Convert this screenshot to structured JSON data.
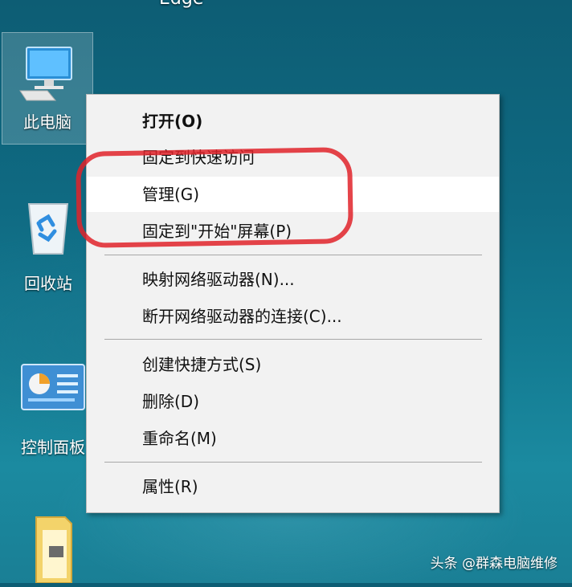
{
  "desktop": {
    "top_partial_label": "Edge",
    "icons": [
      {
        "label": "此电脑",
        "icon": "computer-icon"
      },
      {
        "label": "回收站",
        "icon": "recycle-bin-icon"
      },
      {
        "label": "控制面板",
        "icon": "control-panel-icon"
      },
      {
        "label": "",
        "icon": "folder-icon"
      }
    ]
  },
  "context_menu": {
    "items": [
      {
        "label": "打开(O)",
        "bold": true
      },
      {
        "label": "固定到快速访问"
      },
      {
        "label": "管理(G)",
        "highlighted": true
      },
      {
        "label": "固定到\"开始\"屏幕(P)"
      },
      {
        "label": "映射网络驱动器(N)..."
      },
      {
        "label": "断开网络驱动器的连接(C)..."
      },
      {
        "label": "创建快捷方式(S)"
      },
      {
        "label": "删除(D)"
      },
      {
        "label": "重命名(M)"
      },
      {
        "label": "属性(R)"
      }
    ]
  },
  "annotation": {
    "color": "#e0232a"
  },
  "watermark": "头条 @群森电脑维修"
}
